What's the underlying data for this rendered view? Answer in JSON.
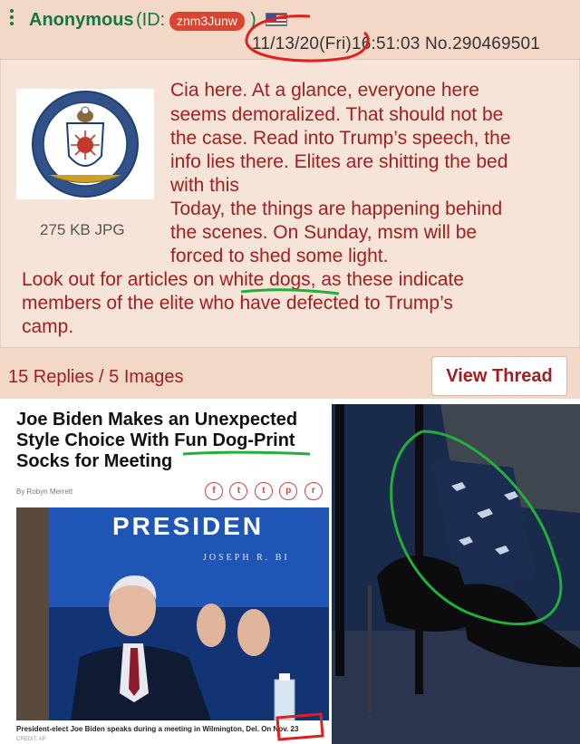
{
  "post": {
    "poster_name": "Anonymous",
    "id_prefix": "(ID:",
    "id_value": "znm3Junw",
    "id_suffix": ")",
    "flag": "us-flag-icon",
    "datetime": "11/13/20(Fri)16:51:03 No.290469501",
    "thumbnail_caption": "275 KB JPG",
    "cia_seal_text": "CENTRAL INTELLIGENCE AGENCY · UNITED STATES OF AMERICA",
    "body_lines": [
      "Cia here. At a glance, everyone here",
      "seems demoralized. That should not be",
      "the case. Read into Trump’s speech, the",
      "info lies there. Elites are shitting the bed",
      "with this",
      "Today, the things are happening behind",
      "the scenes. On Sunday, msm will be",
      "forced to shed some light.",
      "Look out for articles on white dogs, as these indicate",
      "members of the elite who have defected to Trump’s",
      "camp."
    ],
    "replies_summary": "15 Replies / 5 Images",
    "view_thread_label": "View Thread"
  },
  "article": {
    "headline": "Joe Biden Makes an Unexpected Style Choice With Fun Dog-Print Socks for Meeting",
    "byline": "By Robyn Merrett",
    "share_icons": [
      "f",
      "t",
      "t",
      "p",
      "r"
    ],
    "photo_sign_text": "PRESIDEN",
    "photo_sign_subtext": "JOSEPH R. BI",
    "photo_caption": "President-elect Joe Biden speaks during a meeting in Wilmington, Del. On Nov. 23",
    "photo_credit": "CREDIT: AP"
  },
  "colors": {
    "post_bg": "#f7e4d8",
    "header_bg": "#f3d8c8",
    "name_green": "#117743",
    "body_red": "#a02020",
    "id_badge": "#d9452f",
    "annotation_red": "#e0201c",
    "annotation_green": "#22b03a"
  }
}
